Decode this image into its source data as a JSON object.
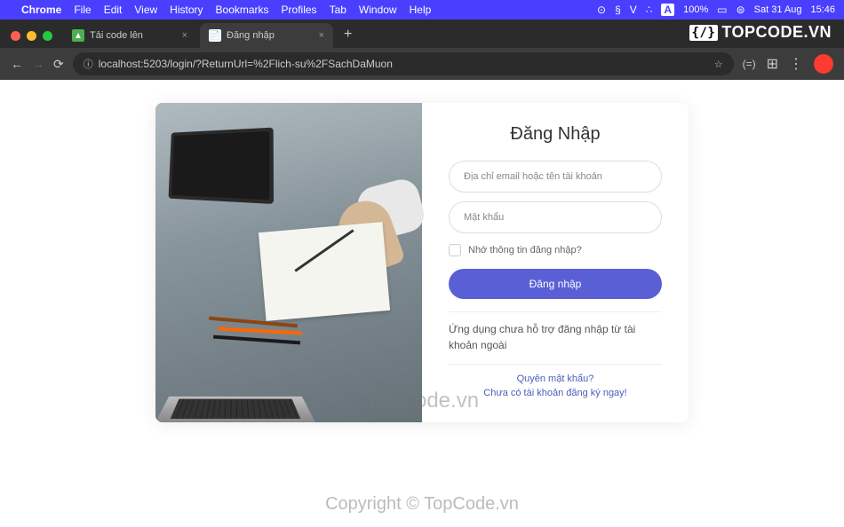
{
  "menubar": {
    "app": "Chrome",
    "items": [
      "File",
      "Edit",
      "View",
      "History",
      "Bookmarks",
      "Profiles",
      "Tab",
      "Window",
      "Help"
    ],
    "battery": "100%",
    "date": "Sat 31 Aug",
    "time": "15:46",
    "indicator": "A",
    "extra": "V"
  },
  "tabs": [
    {
      "title": "Tải code lên",
      "active": false
    },
    {
      "title": "Đăng nhập",
      "active": true
    }
  ],
  "url": "localhost:5203/login/?ReturnUrl=%2Flich-su%2FSachDaMuon",
  "login": {
    "title": "Đăng Nhập",
    "email_placeholder": "Địa chỉ email hoặc tên tài khoản",
    "password_placeholder": "Mật khẩu",
    "remember_label": "Nhớ thông tin đăng nhập?",
    "submit_label": "Đăng nhập",
    "note": "Ứng dụng chưa hỗ trợ đăng nhập từ tài khoản ngoài",
    "forgot_link": "Quyên mật khẩu?",
    "register_link": "Chưa có tài khoản đăng ký ngay!"
  },
  "watermark": {
    "topright": "TOPCODE.VN",
    "center": "TopCode.vn",
    "bottom": "Copyright © TopCode.vn"
  }
}
